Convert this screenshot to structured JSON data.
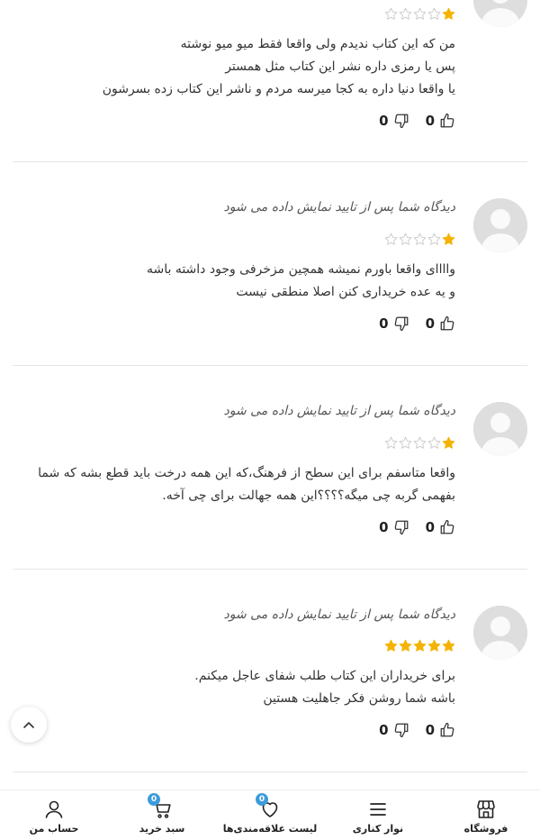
{
  "comments": [
    {
      "moderation_notice": "",
      "rating": 1,
      "lines": [
        "من که این کتاب ندیدم ولی واقعا فقط میو میو نوشته",
        "پس یا رمزی داره نشر این کتاب مثل همستر",
        "یا واقعا دنیا داره به کجا میرسه مردم و ناشر این کتاب زده بسرشون"
      ],
      "likes": "0",
      "dislikes": "0"
    },
    {
      "moderation_notice": "دیدگاه شما پس از تایید نمایش داده می شود",
      "rating": 1,
      "lines": [
        "واااای واقعا باورم نمیشه همچین مزخرفی وجود داشته باشه",
        "و یه عده خریداری کنن اصلا منطقی نیست"
      ],
      "likes": "0",
      "dislikes": "0"
    },
    {
      "moderation_notice": "دیدگاه شما پس از تایید نمایش داده می شود",
      "rating": 1,
      "lines": [
        "واقعا متاسفم برای این سطح از فرهنگ،که این همه درخت باید قطع بشه که شما",
        "بفهمی گربه چی میگه؟؟؟؟این همه جهالت برای چی آخه."
      ],
      "likes": "0",
      "dislikes": "0"
    },
    {
      "moderation_notice": "دیدگاه شما پس از تایید نمایش داده می شود",
      "rating": 5,
      "lines": [
        "برای خریداران این کتاب طلب شفای عاجل میکنم.",
        "باشه شما روشن فکر جاهلیت هستین"
      ],
      "likes": "0",
      "dislikes": "0"
    }
  ],
  "colors": {
    "star_filled": "#f5b301",
    "star_empty": "#c8c8c8",
    "badge": "#3b9bdb"
  },
  "bottom_nav": {
    "items": [
      {
        "label": "فروشگاه",
        "icon": "store-icon"
      },
      {
        "label": "نوار کناری",
        "icon": "menu-icon"
      },
      {
        "label": "لیست علاقه‌مندی‌ها",
        "icon": "heart-icon",
        "badge": "0"
      },
      {
        "label": "سبد خرید",
        "icon": "cart-icon",
        "badge": "0"
      },
      {
        "label": "حساب من",
        "icon": "user-icon"
      }
    ]
  }
}
